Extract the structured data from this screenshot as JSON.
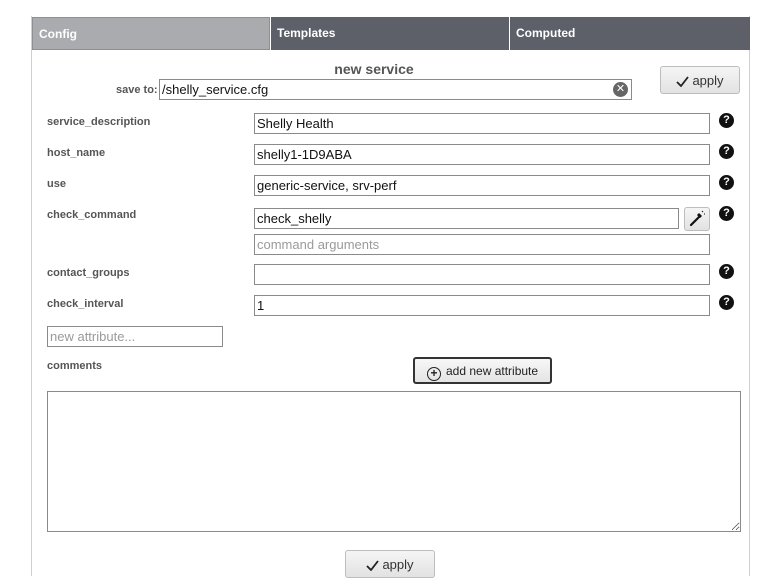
{
  "tabs": [
    {
      "label": "Config"
    },
    {
      "label": "Templates"
    },
    {
      "label": "Computed"
    }
  ],
  "form": {
    "title": "new service",
    "save_to_label": "save to:",
    "save_to_value": "/shelly_service.cfg",
    "apply_label": "apply",
    "fields": {
      "service_description": {
        "label": "service_description",
        "value": "Shelly Health"
      },
      "host_name": {
        "label": "host_name",
        "value": "shelly1-1D9ABA"
      },
      "use": {
        "label": "use",
        "value": "generic-service, srv-perf"
      },
      "check_command": {
        "label": "check_command",
        "value": "check_shelly",
        "args_placeholder": "command arguments"
      },
      "contact_groups": {
        "label": "contact_groups",
        "value": ""
      },
      "check_interval": {
        "label": "check_interval",
        "value": "1"
      }
    },
    "new_attribute_placeholder": "new attribute...",
    "add_attribute_label": "add new attribute",
    "comments_label": "comments",
    "comments_value": "",
    "help_glyph": "?",
    "clear_glyph": "✕"
  },
  "icons": {
    "clear": "clear-icon",
    "help": "help-icon",
    "check": "check-icon",
    "wand": "wand-icon",
    "plus": "plus-circle-icon"
  },
  "colors": {
    "tab_bg": "#5d6068",
    "tab_active_bg": "#a9abae",
    "label_text": "#555555"
  }
}
